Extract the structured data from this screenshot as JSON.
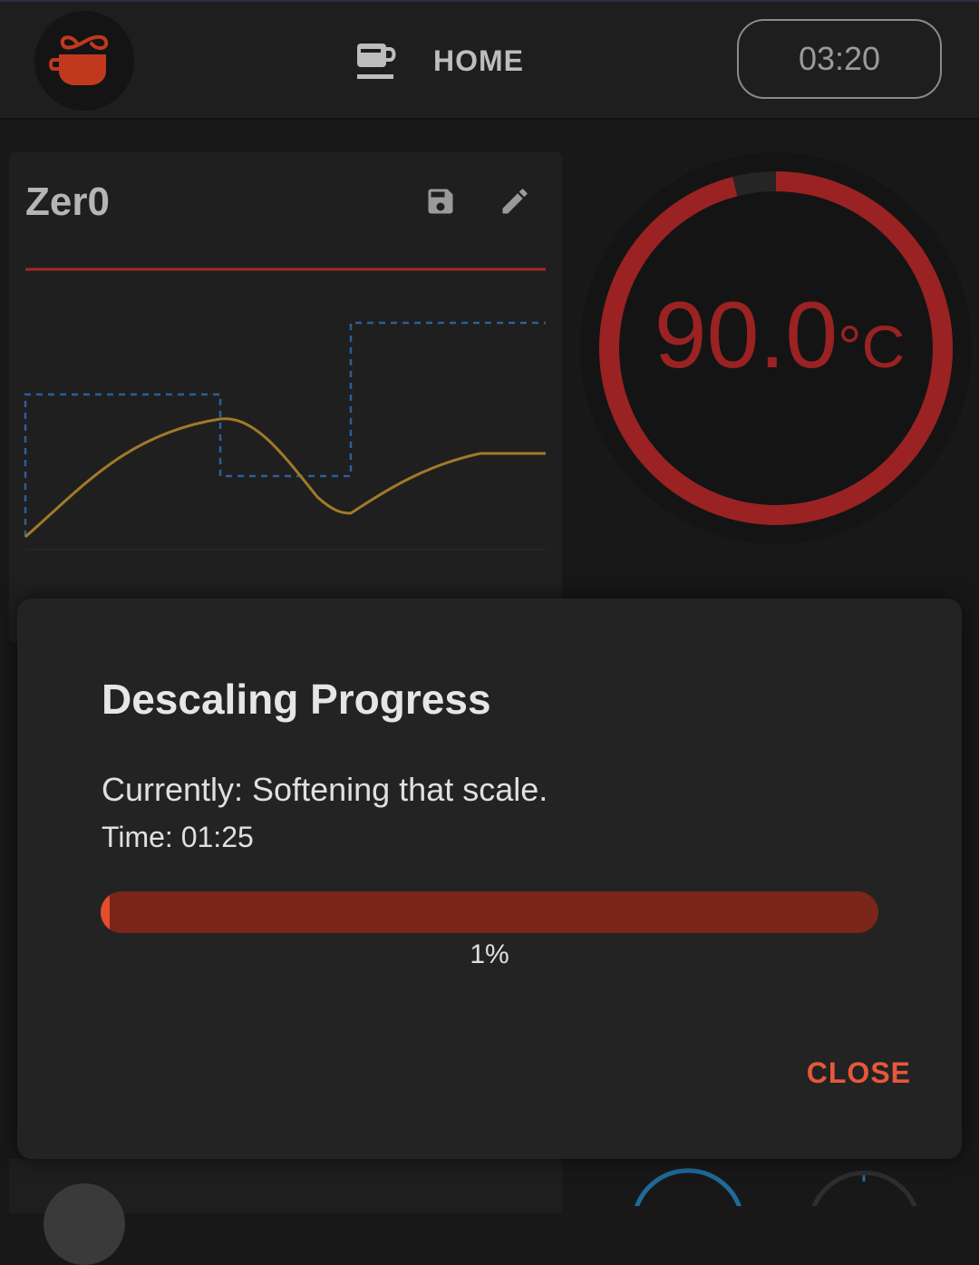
{
  "header": {
    "nav_label": "HOME",
    "timer": "03:20",
    "logo_icon": "coffee-infinity-logo",
    "nav_icon": "coffee-cup-icon"
  },
  "profile_card": {
    "name": "Zer0",
    "save_icon": "save-icon",
    "edit_icon": "edit-icon"
  },
  "temperature": {
    "value": "90.0",
    "unit": "°C",
    "ring_fill_fraction": 0.96,
    "accent": "#9a2222"
  },
  "dialog": {
    "title": "Descaling Progress",
    "status": "Currently: Softening that scale.",
    "time": "Time: 01:25",
    "progress_percent": 1,
    "progress_label": "1%",
    "close_label": "CLOSE",
    "accent": "#e8573a",
    "track_color": "#7a2619"
  }
}
